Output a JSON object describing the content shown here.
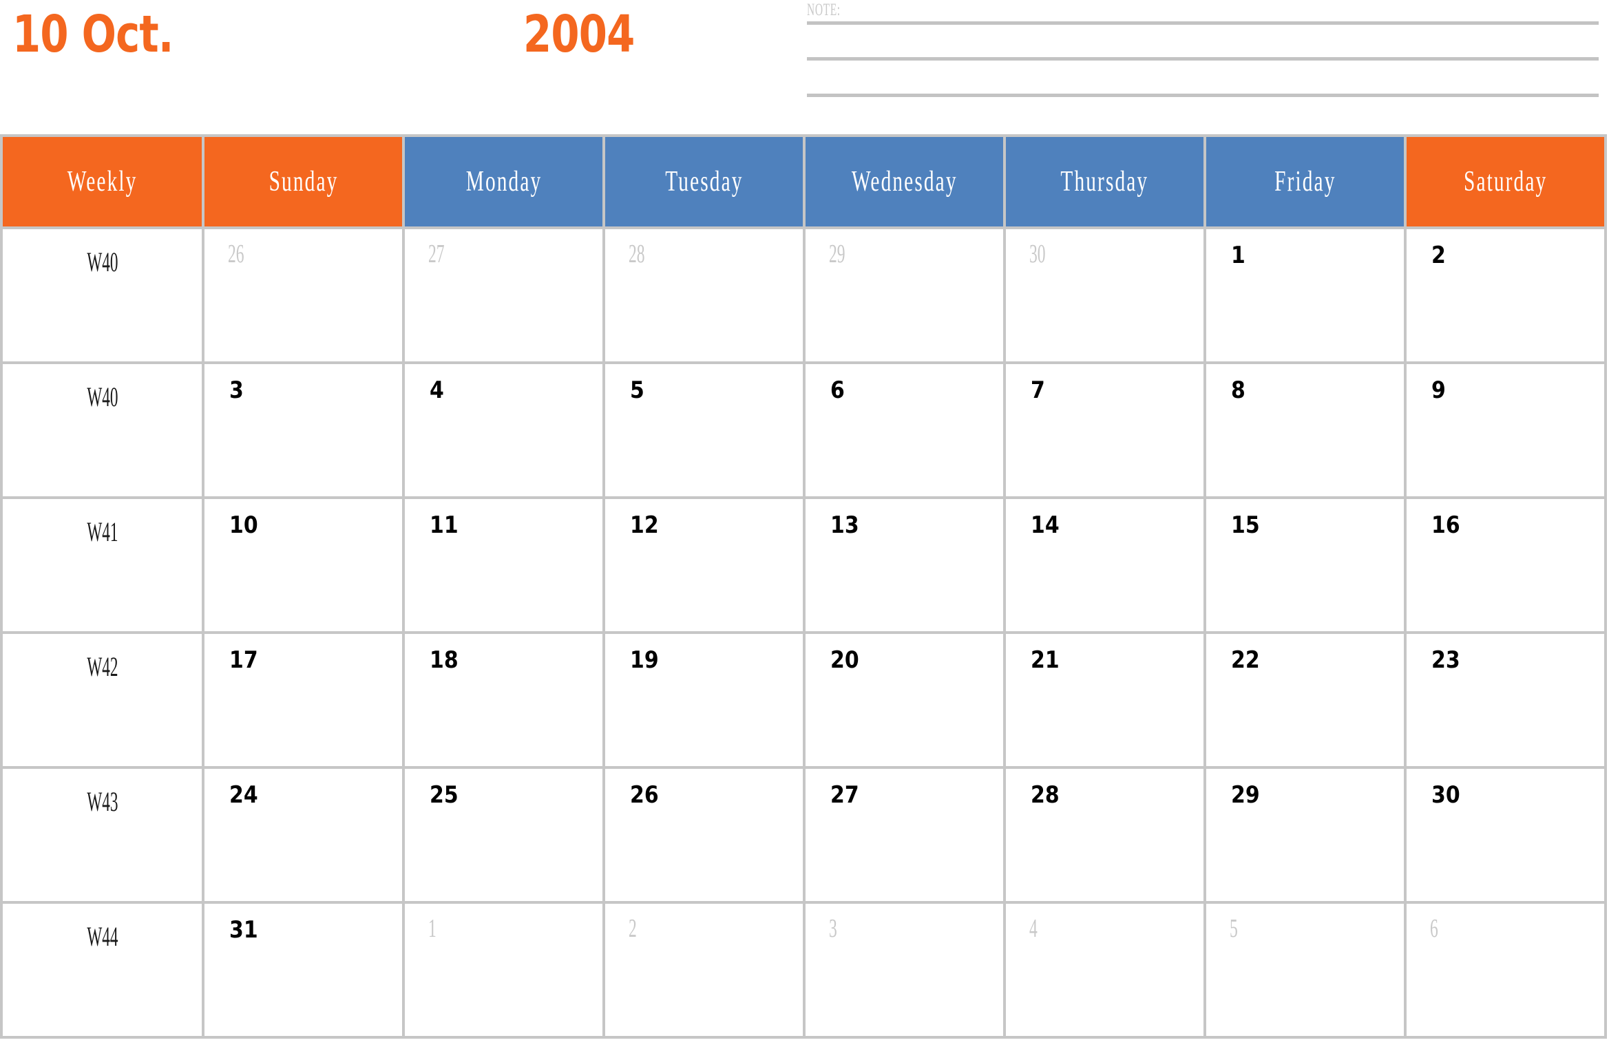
{
  "header": {
    "month_title": "10 Oct.",
    "year_title": "2004",
    "accent_orange": "#F4671F",
    "accent_blue": "#4F81BD"
  },
  "note": {
    "label": "NOTE:",
    "line_count": 3
  },
  "table": {
    "columns": [
      {
        "label": "Weekly",
        "color": "orange"
      },
      {
        "label": "Sunday",
        "color": "orange"
      },
      {
        "label": "Monday",
        "color": "blue"
      },
      {
        "label": "Tuesday",
        "color": "blue"
      },
      {
        "label": "Wednesday",
        "color": "blue"
      },
      {
        "label": "Thursday",
        "color": "blue"
      },
      {
        "label": "Friday",
        "color": "blue"
      },
      {
        "label": "Saturday",
        "color": "orange"
      }
    ],
    "rows": [
      {
        "week": "W40",
        "days": [
          {
            "num": "26",
            "muted": true
          },
          {
            "num": "27",
            "muted": true
          },
          {
            "num": "28",
            "muted": true
          },
          {
            "num": "29",
            "muted": true
          },
          {
            "num": "30",
            "muted": true
          },
          {
            "num": "1",
            "muted": false
          },
          {
            "num": "2",
            "muted": false
          }
        ]
      },
      {
        "week": "W40",
        "days": [
          {
            "num": "3",
            "muted": false
          },
          {
            "num": "4",
            "muted": false
          },
          {
            "num": "5",
            "muted": false
          },
          {
            "num": "6",
            "muted": false
          },
          {
            "num": "7",
            "muted": false
          },
          {
            "num": "8",
            "muted": false
          },
          {
            "num": "9",
            "muted": false
          }
        ]
      },
      {
        "week": "W41",
        "days": [
          {
            "num": "10",
            "muted": false
          },
          {
            "num": "11",
            "muted": false
          },
          {
            "num": "12",
            "muted": false
          },
          {
            "num": "13",
            "muted": false
          },
          {
            "num": "14",
            "muted": false
          },
          {
            "num": "15",
            "muted": false
          },
          {
            "num": "16",
            "muted": false
          }
        ]
      },
      {
        "week": "W42",
        "days": [
          {
            "num": "17",
            "muted": false
          },
          {
            "num": "18",
            "muted": false
          },
          {
            "num": "19",
            "muted": false
          },
          {
            "num": "20",
            "muted": false
          },
          {
            "num": "21",
            "muted": false
          },
          {
            "num": "22",
            "muted": false
          },
          {
            "num": "23",
            "muted": false
          }
        ]
      },
      {
        "week": "W43",
        "days": [
          {
            "num": "24",
            "muted": false
          },
          {
            "num": "25",
            "muted": false
          },
          {
            "num": "26",
            "muted": false
          },
          {
            "num": "27",
            "muted": false
          },
          {
            "num": "28",
            "muted": false
          },
          {
            "num": "29",
            "muted": false
          },
          {
            "num": "30",
            "muted": false
          }
        ]
      },
      {
        "week": "W44",
        "days": [
          {
            "num": "31",
            "muted": false
          },
          {
            "num": "1",
            "muted": true
          },
          {
            "num": "2",
            "muted": true
          },
          {
            "num": "3",
            "muted": true
          },
          {
            "num": "4",
            "muted": true
          },
          {
            "num": "5",
            "muted": true
          },
          {
            "num": "6",
            "muted": true
          }
        ]
      }
    ]
  }
}
